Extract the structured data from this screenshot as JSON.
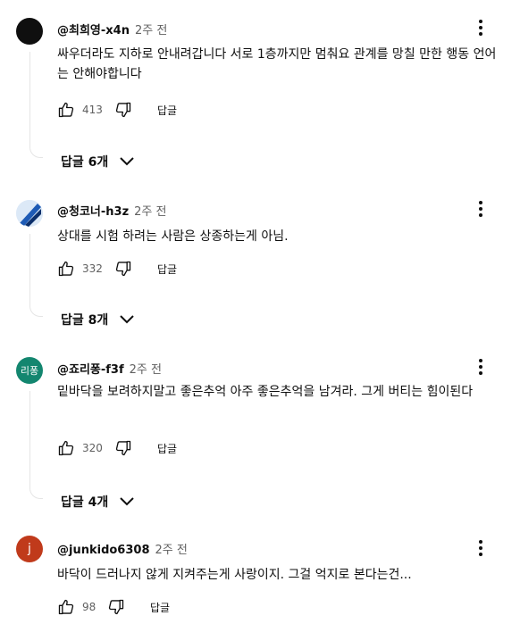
{
  "comments": [
    {
      "author": "@최희영-x4n",
      "time": "2주 전",
      "text": "싸우더라도 지하로 안내려갑니다 서로 1층까지만 멈춰요 관계를 망칠 만한 행동 언어는 안해야합니다",
      "likes": "413",
      "reply_label": "답글",
      "replies_label": "답글 6개"
    },
    {
      "author": "@청코너-h3z",
      "time": "2주 전",
      "text": "상대를 시험 하려는 사람은 상종하는게 아님.",
      "likes": "332",
      "reply_label": "답글",
      "replies_label": "답글 8개"
    },
    {
      "author": "@죠리퐁-f3f",
      "time": "2주 전",
      "avatar_text": "리퐁",
      "text": "밑바닥을 보려하지말고 좋은추억 아주 좋은추억을 남겨라. 그게 버티는 힘이된다",
      "likes": "320",
      "reply_label": "답글",
      "replies_label": "답글 4개"
    },
    {
      "author": "@junkido6308",
      "time": "2주 전",
      "avatar_text": "j",
      "text": "바닥이 드러나지 않게 지켜주는게 사랑이지. 그걸 억지로 본다는건...",
      "likes": "98",
      "reply_label": "답글"
    }
  ],
  "colors": {
    "avatar_1": "#0f0f0f",
    "avatar_3": "#13866f",
    "avatar_4": "#c03a1b",
    "secondary_text": "#606060"
  },
  "icons": [
    "thumbs-up-icon",
    "thumbs-down-icon",
    "more-vert-icon",
    "chevron-down-icon"
  ]
}
